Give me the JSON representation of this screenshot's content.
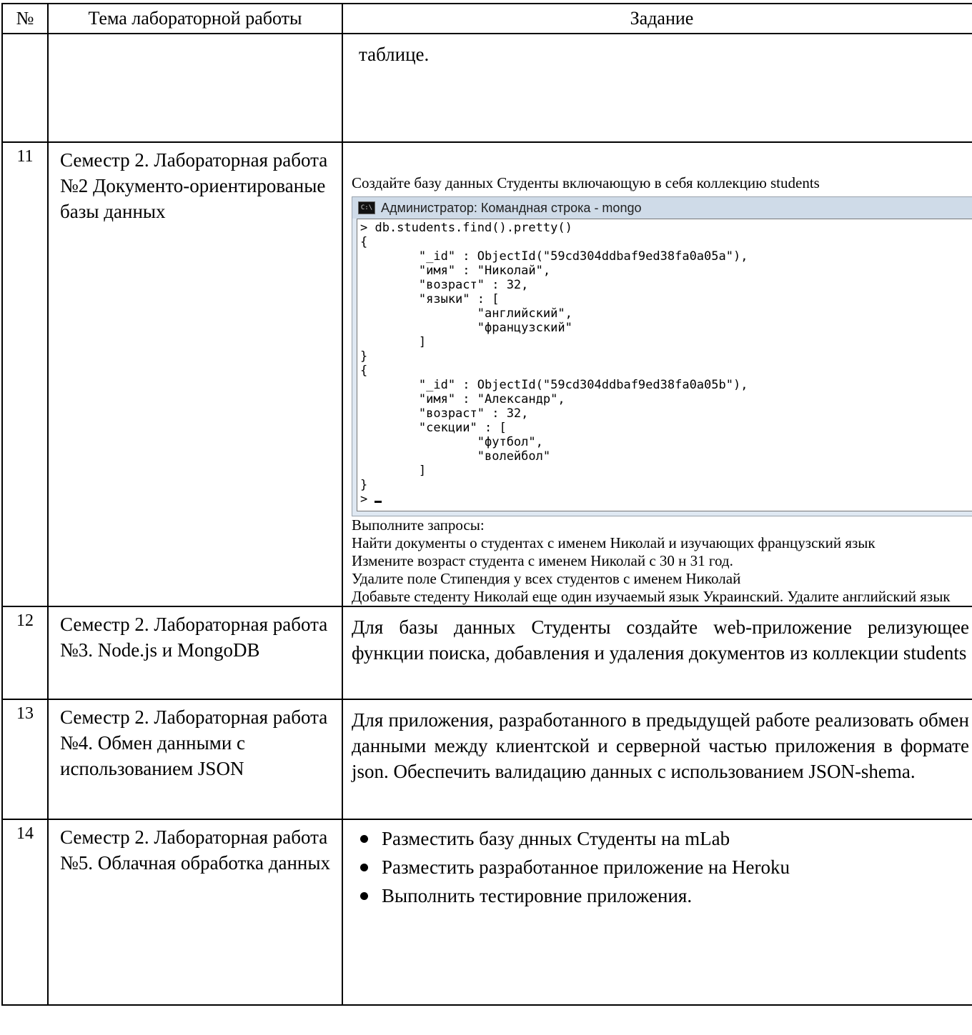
{
  "header": {
    "num": "№",
    "topic": "Тема лабораторной работы",
    "task": "Задание"
  },
  "row_cont": {
    "task": "таблице."
  },
  "row11": {
    "num": "11",
    "topic": "Семестр 2. Лабораторная работа №2 Документо-ориентированые базы данных",
    "intro": "Создайте базу данных Студенты включающую в себя коллекцию students",
    "console": {
      "title": "Администратор: Командная строка - mongo",
      "output": "> db.students.find().pretty()\n{\n        \"_id\" : ObjectId(\"59cd304ddbaf9ed38fa0a05a\"),\n        \"имя\" : \"Николай\",\n        \"возраст\" : 32,\n        \"языки\" : [\n                \"английский\",\n                \"французский\"\n        ]\n}\n{\n        \"_id\" : ObjectId(\"59cd304ddbaf9ed38fa0a05b\"),\n        \"имя\" : \"Александр\",\n        \"возраст\" : 32,\n        \"секции\" : [\n                \"футбол\",\n                \"волейбол\"\n        ]\n}\n> "
    },
    "queries": [
      "Выполните запросы:",
      "Найти документы о студентах с именем Николай и изучающих французский язык",
      "Измените возраст студента с именем Николай с 30 н 31 год.",
      "Удалите поле Стипендия у всех студентов с именем  Николай",
      "Добавьте стеденту Николай еще один изучаемый язык Украинский. Удалите английский язык"
    ]
  },
  "row12": {
    "num": "12",
    "topic": "Семестр 2. Лабораторная работа №3. Node.js и MongoDB",
    "task": "Для базы данных Студенты создайте web-приложение релизующее функции поиска, добавления и удаления документов из коллекции students"
  },
  "row13": {
    "num": "13",
    "topic": "Семестр 2. Лабораторная работа №4. Обмен данными с использованием JSON",
    "task": "Для приложения, разработанного в предыдущей работе реализовать обмен данными между клиентской и серверной частью приложения в формате json. Обеспечить валидацию данных с использованием JSON-shema."
  },
  "row14": {
    "num": "14",
    "topic": "Семестр 2. Лабораторная работа №5. Облачная обработка данных",
    "items": [
      "Разместить базу днных Студенты на mLab",
      "Разместить разработанное приложение на Heroku",
      "Выполнить тестировние приложения."
    ]
  }
}
